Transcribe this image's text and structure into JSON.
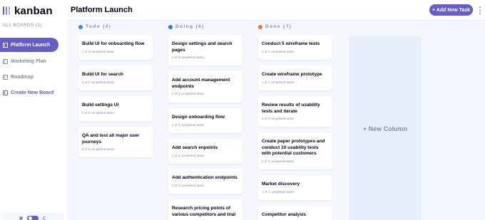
{
  "app": {
    "name": "kanban"
  },
  "sidebar": {
    "heading": "ALL BOARDS (3)",
    "boards": [
      {
        "label": "Platform Launch",
        "active": true
      },
      {
        "label": "Marketing Plan",
        "active": false
      },
      {
        "label": "Roadmap",
        "active": false
      }
    ],
    "create_label": "Create New Board",
    "theme_icons": [
      "sun-icon",
      "moon-icon"
    ]
  },
  "header": {
    "title": "Platform Launch",
    "add_task_label": "+ Add New Task",
    "menu_icon": "vertical-ellipsis-icon"
  },
  "colors": {
    "accent": "#635fc7",
    "todo": "#49c4e5",
    "doing": "#3b82f6",
    "done": "#e8773a",
    "background": "#f4f7fd",
    "muted": "#828fa3"
  },
  "columns": [
    {
      "name": "Todo (4)",
      "color": "#3f88e8",
      "cards": [
        {
          "title": "Build UI for onboarding flow",
          "subtasks": "1 of 3 completed tasks"
        },
        {
          "title": "Build UI for search",
          "subtasks": "0 of 1 completed tasks"
        },
        {
          "title": "Build settings UI",
          "subtasks": "0 of 2 completed tasks"
        },
        {
          "title": "QA and test all major user journeys",
          "subtasks": "0 of 2 completed tasks"
        }
      ]
    },
    {
      "name": "Doing (6)",
      "color": "#2f74e0",
      "cards": [
        {
          "title": "Design settings and search pages",
          "subtasks": "2 of 3 completed tasks"
        },
        {
          "title": "Add account management endpoints",
          "subtasks": "2 of 3 completed tasks"
        },
        {
          "title": "Design onboarding flow",
          "subtasks": "1 of 3 completed tasks"
        },
        {
          "title": "Add search enpoints",
          "subtasks": "1 of 2 completed tasks"
        },
        {
          "title": "Add authentication endpoints",
          "subtasks": "1 of 2 completed tasks"
        },
        {
          "title": "Research pricing points of various competitors and trial",
          "subtasks": ""
        }
      ]
    },
    {
      "name": "Done (7)",
      "color": "#e8773a",
      "cards": [
        {
          "title": "Conduct 5 wireframe tests",
          "subtasks": "1 of 1 completed tasks"
        },
        {
          "title": "Create wireframe prototype",
          "subtasks": "1 of 1 completed tasks"
        },
        {
          "title": "Review results of usability tests and iterate",
          "subtasks": "3 of 3 completed tasks"
        },
        {
          "title": "Create paper prototypes and conduct 10 usability tests with potential customers",
          "subtasks": "2 of 2 completed tasks"
        },
        {
          "title": "Market discovery",
          "subtasks": "1 of 1 completed tasks"
        },
        {
          "title": "Competitor analysis",
          "subtasks": ""
        }
      ]
    }
  ],
  "new_column_label": "+ New Column"
}
